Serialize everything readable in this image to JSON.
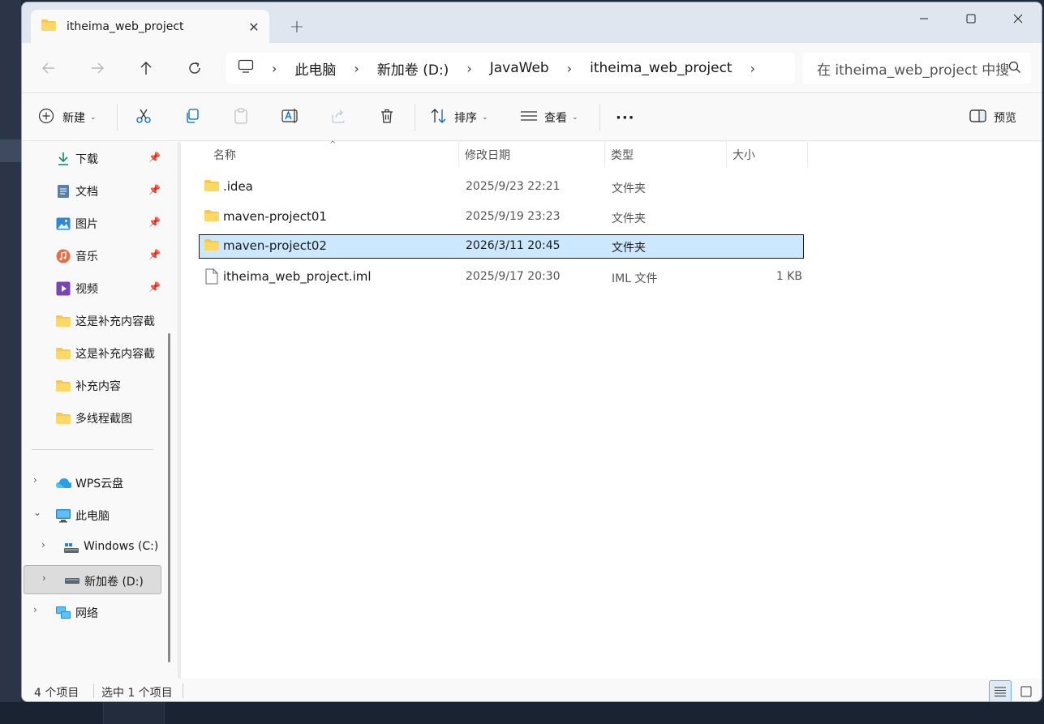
{
  "tab": {
    "title": "itheima_web_project",
    "close": "✕",
    "new_tab": "+"
  },
  "address": {
    "crumbs": [
      "此电脑",
      "新加卷 (D:)",
      "JavaWeb",
      "itheima_web_project"
    ],
    "separator": "›"
  },
  "search": {
    "placeholder": "在 itheima_web_project 中搜"
  },
  "toolbar": {
    "new_label": "新建",
    "sort_label": "排序",
    "view_label": "查看",
    "more_label": "···",
    "preview_label": "预览",
    "caret": "⌄"
  },
  "sidebar": {
    "pin": "📌",
    "quick": [
      {
        "label": "下载",
        "icon": "download-icon"
      },
      {
        "label": "文档",
        "icon": "document-icon"
      },
      {
        "label": "图片",
        "icon": "pictures-icon"
      },
      {
        "label": "音乐",
        "icon": "music-icon"
      },
      {
        "label": "视频",
        "icon": "video-icon"
      },
      {
        "label": "这是补充内容截",
        "icon": "folder-icon"
      },
      {
        "label": "这是补充内容截",
        "icon": "folder-icon"
      },
      {
        "label": "补充内容",
        "icon": "folder-icon"
      },
      {
        "label": "多线程截图",
        "icon": "folder-icon"
      }
    ],
    "tree": [
      {
        "label": "WPS云盘",
        "icon": "cloud-icon"
      },
      {
        "label": "此电脑",
        "icon": "computer-icon"
      },
      {
        "label": "Windows (C:)",
        "icon": "drive-icon"
      },
      {
        "label": "新加卷 (D:)",
        "icon": "drive-icon"
      },
      {
        "label": "网络",
        "icon": "network-icon"
      }
    ]
  },
  "columns": {
    "name": "名称",
    "date": "修改日期",
    "type": "类型",
    "size": "大小"
  },
  "files": [
    {
      "name": ".idea",
      "date": "2025/9/23 22:21",
      "type": "文件夹",
      "size": ""
    },
    {
      "name": "maven-project01",
      "date": "2025/9/19 23:23",
      "type": "文件夹",
      "size": ""
    },
    {
      "name": "maven-project02",
      "date": "2026/3/11 20:45",
      "type": "文件夹",
      "size": ""
    },
    {
      "name": "itheima_web_project.iml",
      "date": "2025/9/17 20:30",
      "type": "IML 文件",
      "size": "1 KB"
    }
  ],
  "status": {
    "count": "4 个项目",
    "selected": "选中 1 个项目"
  },
  "colors": {
    "selection_bg": "#cce8ff",
    "folder_yellow": "#f8c94a",
    "accent": "#0067c0"
  }
}
